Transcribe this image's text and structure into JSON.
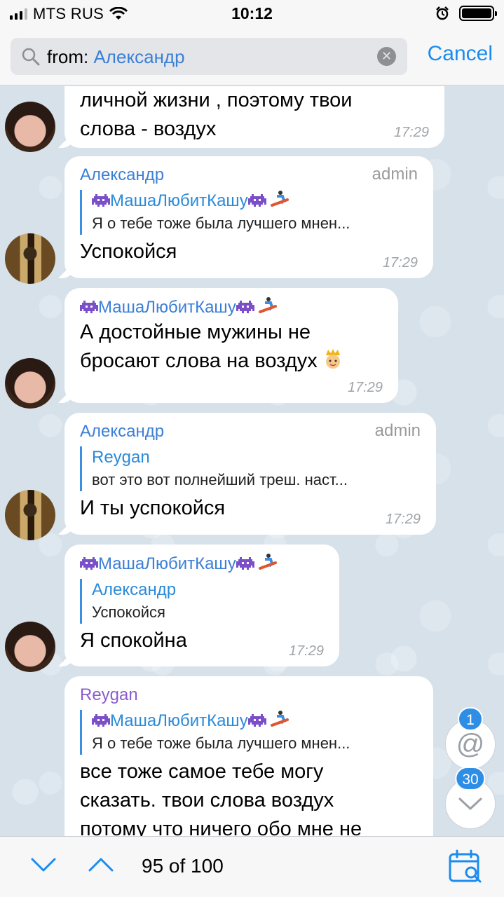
{
  "status_bar": {
    "carrier": "MTS RUS",
    "time": "10:12"
  },
  "search": {
    "prefix": "from:",
    "token": "Александр",
    "cancel_label": "Cancel"
  },
  "messages": [
    {
      "sender": "",
      "lines": [
        "личной жизни , поэтому твои",
        "слова - воздух"
      ],
      "time": "17:29"
    },
    {
      "sender": "Александр",
      "role": "admin",
      "reply_name": "МашаЛюбитКашу",
      "reply_text": "Я о тебе тоже была лучшего мнен...",
      "text": "Успокойся",
      "time": "17:29"
    },
    {
      "sender": "МашаЛюбитКашу",
      "lines": [
        "А достойные мужины не",
        "бросают слова на воздух"
      ],
      "time": "17:29"
    },
    {
      "sender": "Александр",
      "role": "admin",
      "reply_name": "Reygan",
      "reply_text": "вот это вот полнейший треш. наст...",
      "text": "И ты успокойся",
      "time": "17:29"
    },
    {
      "sender": "МашаЛюбитКашу",
      "reply_name": "Александр",
      "reply_text": "Успокойся",
      "text": "Я спокойна",
      "time": "17:29"
    },
    {
      "sender": "Reygan",
      "reply_name": "МашаЛюбитКашу",
      "reply_text": "Я о тебе тоже была лучшего мнен...",
      "lines": [
        "все тоже самое тебе могу",
        "сказать. твои слова воздух",
        "потому что ничего обо мне не"
      ]
    }
  ],
  "mentions_badge": "1",
  "unread_badge": "30",
  "bottom_bar": {
    "counter": "95 of 100"
  },
  "icons": {
    "search": "search-icon",
    "clear": "clear-icon",
    "at": "mention-icon",
    "down": "chevron-down-icon",
    "up": "chevron-up-icon",
    "calendar": "calendar-search-icon"
  },
  "colors": {
    "accent": "#1a8cf0",
    "sender_blue": "#3b7fd6",
    "sender_violet": "#8a5cd0",
    "badge": "#2e8ee6"
  }
}
